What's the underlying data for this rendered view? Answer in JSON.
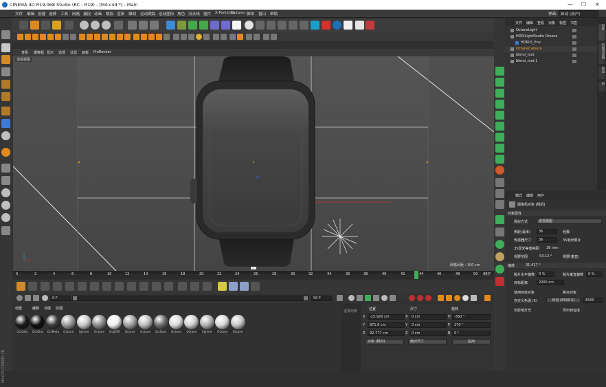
{
  "window": {
    "title": "CINEMA 4D R19.068 Studio (RC - R19) - [M4.c4d *] - Main",
    "minimize": "—",
    "maximize": "☐",
    "close": "✕"
  },
  "menu": [
    "文件",
    "编辑",
    "创建",
    "选择",
    "工具",
    "网格",
    "捕捉",
    "动画",
    "模拟",
    "渲染",
    "雕刻",
    "运动跟踪",
    "运动图形",
    "角色",
    "流水线",
    "插件",
    "X-Particles",
    "Octane",
    "脚本",
    "窗口",
    "帮助"
  ],
  "menu_right": {
    "layout_label": "界面:",
    "layout_value": "启动 (用户)"
  },
  "viewport": {
    "menu": [
      "查看",
      "摄像机",
      "显示",
      "选项",
      "过滤",
      "面板",
      "ProRender"
    ],
    "camera_tag": "透视视图",
    "grid_spacing": "网格间距 : 100 cm"
  },
  "timeline": {
    "ticks": [
      "0",
      "2",
      "4",
      "6",
      "8",
      "10",
      "12",
      "14",
      "16",
      "18",
      "20",
      "22",
      "24",
      "26",
      "28",
      "30",
      "32",
      "34",
      "36",
      "38",
      "40",
      "42",
      "44",
      "46",
      "48",
      "50"
    ],
    "current_frame_label": "44 F",
    "start_field": "0 F",
    "end_field": "50 F",
    "min_field": "0 F",
    "max_field": "50 F"
  },
  "material_manager": {
    "menu": [
      "创建",
      "编辑",
      "功能",
      "纹理"
    ],
    "materials": [
      {
        "name": "OctGlos",
        "color": "#1a1a1a"
      },
      {
        "name": "OctGlos",
        "color": "#111111"
      },
      {
        "name": "OctMeta",
        "color": "#3a3a3a"
      },
      {
        "name": "Octane",
        "color": "#9a9a9a"
      },
      {
        "name": "Sphere",
        "color": "#c8c8c8"
      },
      {
        "name": "Octane",
        "color": "#8c8c8c"
      },
      {
        "name": "OctDiffi",
        "color": "#f0f0f0"
      },
      {
        "name": "Octane",
        "color": "#a0a0a0"
      },
      {
        "name": "Octane",
        "color": "#bdbdbd"
      },
      {
        "name": "OctSpec",
        "color": "#6a6a6a"
      },
      {
        "name": "Octane",
        "color": "#dadada"
      },
      {
        "name": "Octane",
        "color": "#cfcfcf"
      },
      {
        "name": "Sphere",
        "color": "#b0b0b0"
      },
      {
        "name": "Octane",
        "color": "#d8d8d8"
      },
      {
        "name": "Octane",
        "color": "#c5c5c5"
      }
    ]
  },
  "coords": {
    "side_tag": "选择对象",
    "headers": [
      "位置",
      "尺寸",
      "旋转"
    ],
    "rows": [
      {
        "axis": "X",
        "pos": "-25.926 cm",
        "size_axis": "X",
        "size": "0 cm",
        "rot_axis": "H",
        "rot": "-360 °"
      },
      {
        "axis": "Y",
        "pos": "871.6 cm",
        "size_axis": "Y",
        "size": "0 cm",
        "rot_axis": "P",
        "rot": "270 °"
      },
      {
        "axis": "Z",
        "pos": "92.777 cm",
        "size_axis": "Z",
        "size": "0 cm",
        "rot_axis": "B",
        "rot": "0 °"
      }
    ],
    "mode_select": "对象 (相对)",
    "size_select": "绝对尺寸",
    "apply": "应用"
  },
  "objects": {
    "tabs": [
      "文件",
      "编辑",
      "查看",
      "对象",
      "标签",
      "书签"
    ],
    "rows": [
      {
        "name": "OctaneLight",
        "color": "#e0e0e0"
      },
      {
        "name": "HDRILightStudio Octane",
        "color": "#e0e0e0"
      },
      {
        "name": "HDRLS_Env",
        "color": "#e0e0e0"
      },
      {
        "name": "OctaneCamera",
        "color": "#f2a33a"
      },
      {
        "name": "blend_root",
        "color": "#e0e0e0"
      },
      {
        "name": "blend_root.1",
        "color": "#e0e0e0"
      }
    ],
    "side_tabs": [
      "对象",
      "内容浏览器",
      "构造",
      "层"
    ]
  },
  "attributes": {
    "tabs": [
      "模式",
      "编辑",
      "用户"
    ],
    "title": "摄像机对象 [相机]",
    "section": "对象属性",
    "projection_label": "投射方式",
    "projection_value": "透视视图",
    "focal_label": "焦距(毫米)",
    "focal_value": "36",
    "focal_right": "经典",
    "sensor_label": "传感器尺寸",
    "sensor_value": "36",
    "sensor_right": "35毫米照片",
    "zoom_label": "35毫米等值焦距:",
    "zoom_value": "36 mm",
    "fov_label": "视野范围",
    "fov_value": "53.13 °",
    "fov_v_label": "视野(垂直)",
    "fov_v_value": "31.417 °",
    "zoom2_label": "缩放",
    "film_label": "胶片水平偏移",
    "film_value": "0 %",
    "film_v_label": "胶片垂直偏移",
    "film_v_value": "0 %",
    "focus_label": "目标距离",
    "focus_value": "2000 cm",
    "focus_obj_label": "使用目标对象",
    "focus_obj2": "焦点对象",
    "wb_label": "自定义色温 (K)",
    "wb_value": "日光 (6500 K)",
    "wb_field": "6500",
    "export_label": "仅影响灯光",
    "export2": "导出到合成",
    "rows_extra": [
      "对象",
      "物理",
      "细节",
      "立体",
      "合成",
      "球面"
    ]
  },
  "status": {
    "brand": "MAXON CINEMA 4D"
  }
}
